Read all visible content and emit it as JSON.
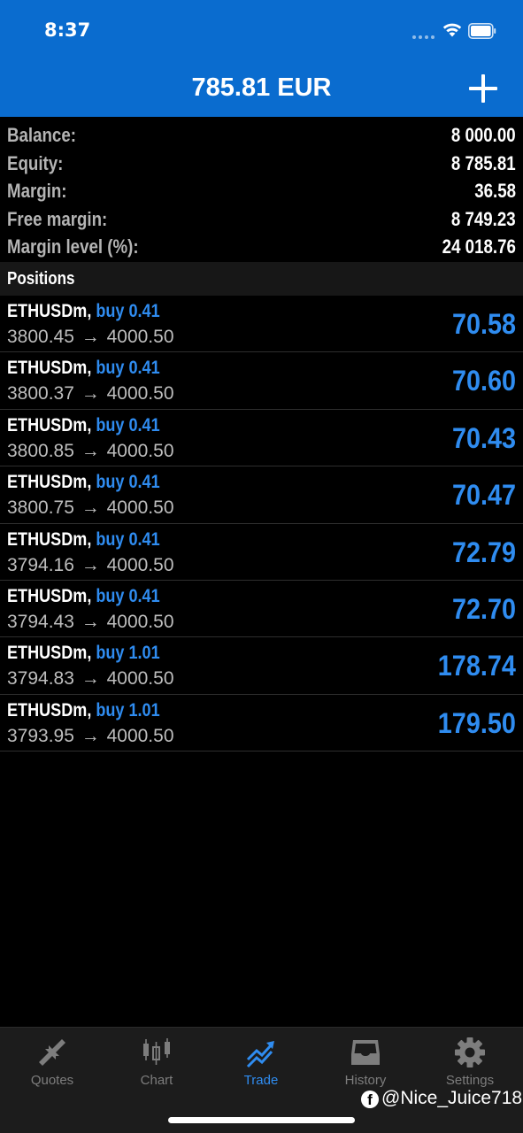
{
  "status_bar": {
    "time": "8:37"
  },
  "header": {
    "title": "785.81 EUR"
  },
  "summary": [
    {
      "label": "Balance:",
      "value": "8 000.00"
    },
    {
      "label": "Equity:",
      "value": "8 785.81"
    },
    {
      "label": "Margin:",
      "value": "36.58"
    },
    {
      "label": "Free margin:",
      "value": "8 749.23"
    },
    {
      "label": "Margin level (%):",
      "value": "24 018.76"
    }
  ],
  "positions_header": "Positions",
  "positions": [
    {
      "symbol": "ETHUSDm",
      "direction": "buy 0.41",
      "open": "3800.45",
      "current": "4000.50",
      "profit": "70.58"
    },
    {
      "symbol": "ETHUSDm",
      "direction": "buy 0.41",
      "open": "3800.37",
      "current": "4000.50",
      "profit": "70.60"
    },
    {
      "symbol": "ETHUSDm",
      "direction": "buy 0.41",
      "open": "3800.85",
      "current": "4000.50",
      "profit": "70.43"
    },
    {
      "symbol": "ETHUSDm",
      "direction": "buy 0.41",
      "open": "3800.75",
      "current": "4000.50",
      "profit": "70.47"
    },
    {
      "symbol": "ETHUSDm",
      "direction": "buy 0.41",
      "open": "3794.16",
      "current": "4000.50",
      "profit": "72.79"
    },
    {
      "symbol": "ETHUSDm",
      "direction": "buy 0.41",
      "open": "3794.43",
      "current": "4000.50",
      "profit": "72.70"
    },
    {
      "symbol": "ETHUSDm",
      "direction": "buy 1.01",
      "open": "3794.83",
      "current": "4000.50",
      "profit": "178.74"
    },
    {
      "symbol": "ETHUSDm",
      "direction": "buy 1.01",
      "open": "3793.95",
      "current": "4000.50",
      "profit": "179.50"
    }
  ],
  "tabs": [
    {
      "label": "Quotes",
      "icon": "quotes-arrows-icon"
    },
    {
      "label": "Chart",
      "icon": "candlestick-chart-icon"
    },
    {
      "label": "Trade",
      "icon": "trade-trend-icon",
      "active": true
    },
    {
      "label": "History",
      "icon": "inbox-tray-icon"
    },
    {
      "label": "Settings",
      "icon": "gear-icon"
    }
  ],
  "watermark": {
    "text": "@Nice_Juice718"
  },
  "colors": {
    "header_blue": "#0a6ccf",
    "accent_blue": "#2f8cf0",
    "label_gray": "#b4b4b4",
    "background": "#000000"
  }
}
